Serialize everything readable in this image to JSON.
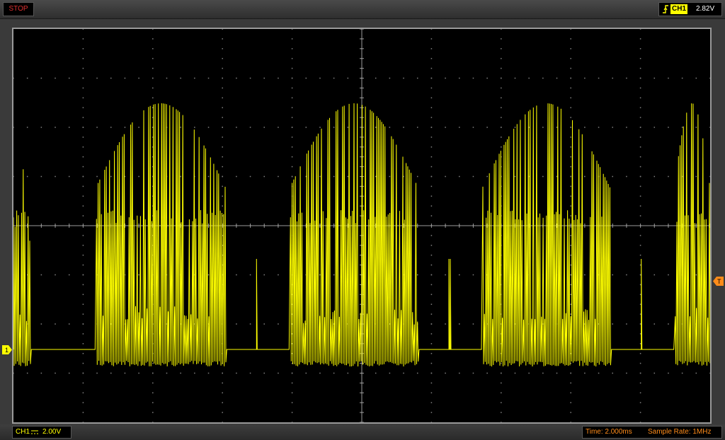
{
  "status": {
    "label": "STOP",
    "color": "#e03030"
  },
  "trigger": {
    "edge_icon": "rising-edge-icon",
    "channel": "CH1",
    "level": "2.82V"
  },
  "channel": {
    "name": "CH1",
    "coupling_icon": "dc-coupling-icon",
    "scale": "2.00V",
    "marker": "1",
    "color": "#ffff00"
  },
  "timebase": {
    "time": "Time: 2.000ms",
    "sample_rate": "Sample Rate: 1MHz"
  },
  "trigger_marker": "T",
  "colors": {
    "trace": "#ffff00",
    "grid": "#808080",
    "background": "#000000",
    "text_orange": "#ff8c1a"
  }
}
